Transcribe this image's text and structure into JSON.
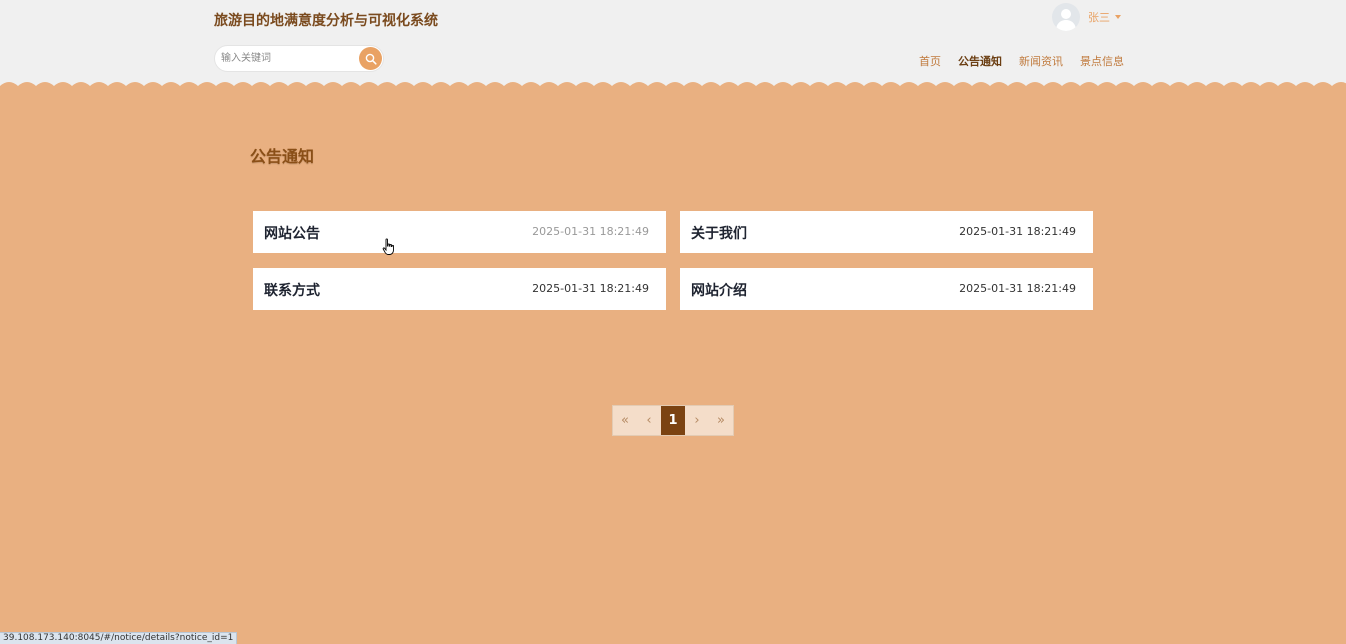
{
  "header": {
    "site_title": "旅游目的地满意度分析与可视化系统",
    "search": {
      "placeholder": "输入关键词",
      "value": ""
    },
    "search_icon": "search-icon",
    "user": {
      "name": "张三",
      "avatar_icon": "user-avatar-icon"
    },
    "nav": [
      {
        "label": "首页",
        "active": false
      },
      {
        "label": "公告通知",
        "active": true
      },
      {
        "label": "新闻资讯",
        "active": false
      },
      {
        "label": "景点信息",
        "active": false
      }
    ]
  },
  "main": {
    "heading": "公告通知",
    "notices": [
      {
        "title": "网站公告",
        "time": "2025-01-31 18:21:49"
      },
      {
        "title": "关于我们",
        "time": "2025-01-31 18:21:49"
      },
      {
        "title": "联系方式",
        "time": "2025-01-31 18:21:49"
      },
      {
        "title": "网站介绍",
        "time": "2025-01-31 18:21:49"
      }
    ]
  },
  "pagination": {
    "first": "«",
    "prev": "‹",
    "current": "1",
    "next": "›",
    "last": "»"
  },
  "status_bar": {
    "url": "39.108.173.140:8045/#/notice/details?notice_id=1"
  },
  "colors": {
    "background": "#e9b081",
    "header_bg": "#f0f0f0",
    "accent": "#e9a264",
    "title_brown": "#7a4a1e",
    "pager_current": "#7b4312"
  }
}
